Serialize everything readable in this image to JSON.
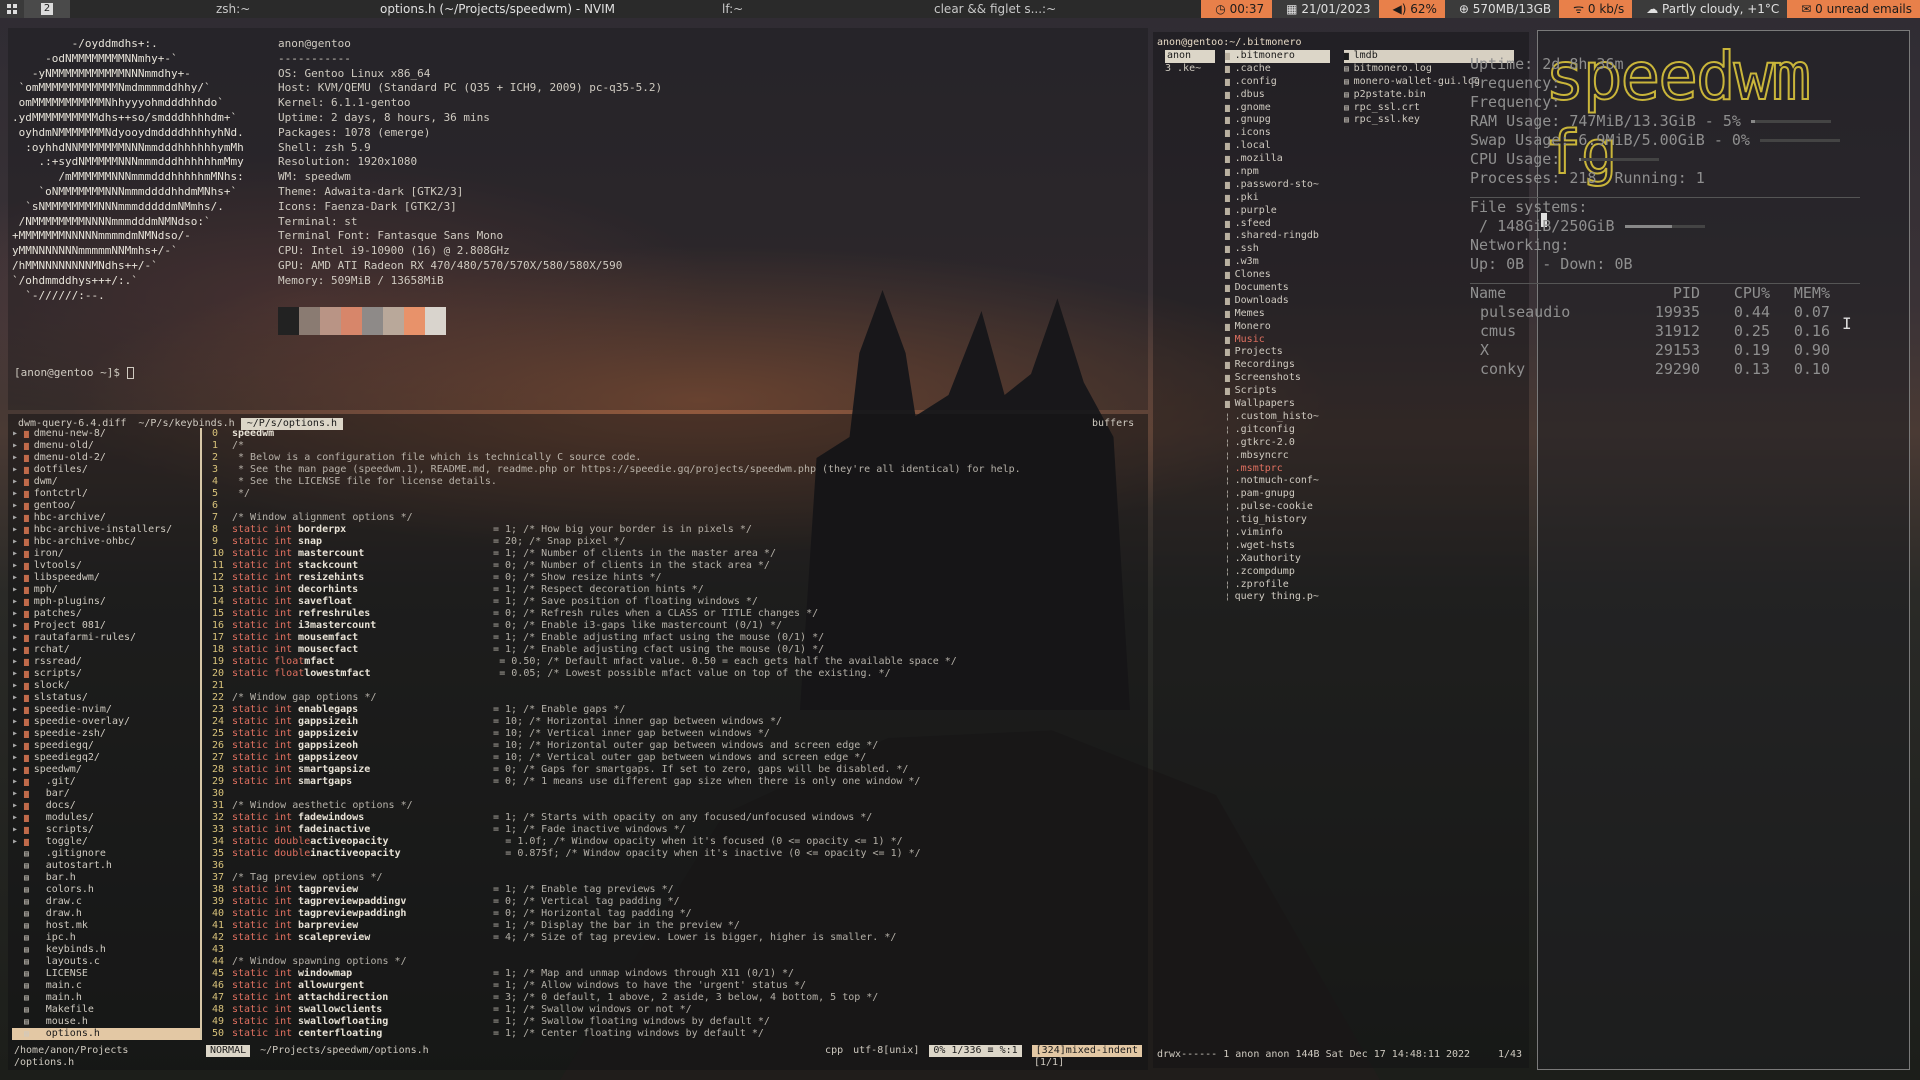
{
  "topbar": {
    "tags": [
      "1",
      "2"
    ],
    "titles": {
      "zsh": "zsh:~",
      "nvim": "options.h (~/Projects/speedwm) - NVIM",
      "lf": "lf:~",
      "clear": "clear && figlet s...:~"
    },
    "time": "00:37",
    "date": "21/01/2023",
    "volume": "62%",
    "ram": "570MB/13GB",
    "net": "0 kb/s",
    "weather": "Partly cloudy, +1°C",
    "mail": "0 unread emails"
  },
  "neofetch": {
    "logo": [
      "         -/oyddmdhs+:.",
      "     -odNMMMMMMMMNNmhy+-`",
      "   -yNMMMMMMMMMMMNNNmmdhy+-",
      " `omMMMMMMMMMMMMNmdmmmmddhhy/`",
      " omMMMMMMMMMMMNhhyyyohmdddhhhdo`",
      ".ydMMMMMMMMMMdhs++so/smdddhhhhdm+`",
      " oyhdmNMMMMMMMNdyooydmddddhhhhyhNd.",
      "  :oyhhdNNMMMMMMMNNNmmdddhhhhhhymMh",
      "    .:+sydNMMMMMNNNmmmdddhhhhhhmMmy",
      "       /mMMMMMMNNNmmmdddhhhhhmMNhs:",
      "    `oNMMMMMMMNNNmmmddddhhdmMNhs+`",
      "  `sNMMMMMMMMNNNmmmdddddmNMmhs/.",
      " /NMMMMMMMMNNNNmmmdddmNMNdso:`",
      "+MMMMMMMNNNNNmmmmdmNMNdso/-",
      "yMMNNNNNNNmmmmmNNMmhs+/-`",
      "/hMMNNNNNNNNMNdhs++/-`",
      "`/ohdmmddhys+++/:.`",
      "  `-//////:--."
    ],
    "user": "anon@gentoo",
    "separator": "-----------",
    "info": [
      "OS: Gentoo Linux x86_64",
      "Host: KVM/QEMU (Standard PC (Q35 + ICH9, 2009) pc-q35-5.2)",
      "Kernel: 6.1.1-gentoo",
      "Uptime: 2 days, 8 hours, 36 mins",
      "Packages: 1078 (emerge)",
      "Shell: zsh 5.9",
      "Resolution: 1920x1080",
      "WM: speedwm",
      "Theme: Adwaita-dark [GTK2/3]",
      "Icons: Faenza-Dark [GTK2/3]",
      "Terminal: st",
      "Terminal Font: Fantasque Sans Mono",
      "CPU: Intel i9-10900 (16) @ 2.808GHz",
      "GPU: AMD ATI Radeon RX 470/480/570/570X/580/580X/590",
      "Memory: 509MiB / 13658MiB"
    ],
    "palette": [
      "#222222",
      "#8a7b72",
      "#b99485",
      "#d7866a",
      "#8e8a88",
      "#b9a89a",
      "#e8926a",
      "#d9d4cd"
    ],
    "prompt": "[anon@gentoo ~]$ "
  },
  "nvim": {
    "tabs": [
      "dwm-query-6.4.diff",
      "~/P/s/keybinds.h",
      "~/P/s/options.h"
    ],
    "buffers_label": "buffers",
    "tree": [
      "dmenu-new-8/",
      "dmenu-old/",
      "dmenu-old-2/",
      "dotfiles/",
      "dwm/",
      "fontctrl/",
      "gentoo/",
      "hbc-archive/",
      "hbc-archive-installers/",
      "hbc-archive-ohbc/",
      "iron/",
      "lvtools/",
      "libspeedwm/",
      "mph/",
      "mph-plugins/",
      "patches/",
      "Project 081/",
      "rautafarmi-rules/",
      "rchat/",
      "rssread/",
      "scripts/",
      "slock/",
      "slstatus/",
      "speedie-nvim/",
      "speedie-overlay/",
      "speedie-zsh/",
      "speediegq/",
      "speediegq2/",
      "speedwm/",
      "  .git/",
      "  bar/",
      "  docs/",
      "  modules/",
      "  scripts/",
      "  toggle/",
      "  .gitignore",
      "  autostart.h",
      "  bar.h",
      "  colors.h",
      "  draw.c",
      "  draw.h",
      "  host.mk",
      "  ipc.h",
      "  keybinds.h",
      "  layouts.c",
      "  LICENSE",
      "  main.c",
      "  main.h",
      "  Makefile",
      "  mouse.h",
      "  options.h"
    ],
    "tree_footer": "/home/anon/Projects",
    "code": [
      {
        "n": "0",
        "t": "",
        "v": "speedwm",
        "c": ""
      },
      {
        "n": "1",
        "t": "",
        "v": "",
        "c": "/*"
      },
      {
        "n": "2",
        "t": "",
        "v": "",
        "c": " * Below is a configuration file which is technically C source code."
      },
      {
        "n": "3",
        "t": "",
        "v": "",
        "c": " * See the man page (speedwm.1), README.md, readme.php or https://speedie.gq/projects/speedwm.php (they're all identical) for help."
      },
      {
        "n": "4",
        "t": "",
        "v": "",
        "c": " * See the LICENSE file for license details."
      },
      {
        "n": "5",
        "t": "",
        "v": "",
        "c": " */"
      },
      {
        "n": "6",
        "t": "",
        "v": "",
        "c": ""
      },
      {
        "n": "7",
        "t": "",
        "v": "",
        "c": "/* Window alignment options */"
      },
      {
        "n": "8",
        "t": "static int",
        "v": "borderpx",
        "c": "= 1; /* How big your border is in pixels */"
      },
      {
        "n": "9",
        "t": "static int",
        "v": "snap",
        "c": "= 20; /* Snap pixel */"
      },
      {
        "n": "10",
        "t": "static int",
        "v": "mastercount",
        "c": "= 1; /* Number of clients in the master area */"
      },
      {
        "n": "11",
        "t": "static int",
        "v": "stackcount",
        "c": "= 0; /* Number of clients in the stack area */"
      },
      {
        "n": "12",
        "t": "static int",
        "v": "resizehints",
        "c": "= 0; /* Show resize hints */"
      },
      {
        "n": "13",
        "t": "static int",
        "v": "decorhints",
        "c": "= 1; /* Respect decoration hints */"
      },
      {
        "n": "14",
        "t": "static int",
        "v": "savefloat",
        "c": "= 1; /* Save position of floating windows */"
      },
      {
        "n": "15",
        "t": "static int",
        "v": "refreshrules",
        "c": "= 0; /* Refresh rules when a CLASS or TITLE changes */"
      },
      {
        "n": "16",
        "t": "static int",
        "v": "i3mastercount",
        "c": "= 0; /* Enable i3-gaps like mastercount (0/1) */"
      },
      {
        "n": "17",
        "t": "static int",
        "v": "mousemfact",
        "c": "= 1; /* Enable adjusting mfact using the mouse (0/1) */"
      },
      {
        "n": "18",
        "t": "static int",
        "v": "mousecfact",
        "c": "= 1; /* Enable adjusting cfact using the mouse (0/1) */"
      },
      {
        "n": "19",
        "t": "static float",
        "v": "mfact",
        "c": "= 0.50; /* Default mfact value. 0.50 = each gets half the available space */"
      },
      {
        "n": "20",
        "t": "static float",
        "v": "lowestmfact",
        "c": "= 0.05; /* Lowest possible mfact value on top of the existing. */"
      },
      {
        "n": "21",
        "t": "",
        "v": "",
        "c": ""
      },
      {
        "n": "22",
        "t": "",
        "v": "",
        "c": "/* Window gap options */"
      },
      {
        "n": "23",
        "t": "static int",
        "v": "enablegaps",
        "c": "= 1; /* Enable gaps */"
      },
      {
        "n": "24",
        "t": "static int",
        "v": "gappsizeih",
        "c": "= 10; /* Horizontal inner gap between windows */"
      },
      {
        "n": "25",
        "t": "static int",
        "v": "gappsizeiv",
        "c": "= 10; /* Vertical inner gap between windows */"
      },
      {
        "n": "26",
        "t": "static int",
        "v": "gappsizeoh",
        "c": "= 10; /* Horizontal outer gap between windows and screen edge */"
      },
      {
        "n": "27",
        "t": "static int",
        "v": "gappsizeov",
        "c": "= 10; /* Vertical outer gap between windows and screen edge */"
      },
      {
        "n": "28",
        "t": "static int",
        "v": "smartgapsize",
        "c": "= 0; /* Gaps for smartgaps. If set to zero, gaps will be disabled. */"
      },
      {
        "n": "29",
        "t": "static int",
        "v": "smartgaps",
        "c": "= 0; /* 1 means use different gap size when there is only one window */"
      },
      {
        "n": "30",
        "t": "",
        "v": "",
        "c": ""
      },
      {
        "n": "31",
        "t": "",
        "v": "",
        "c": "/* Window aesthetic options */"
      },
      {
        "n": "32",
        "t": "static int",
        "v": "fadewindows",
        "c": "= 1; /* Starts with opacity on any focused/unfocused windows */"
      },
      {
        "n": "33",
        "t": "static int",
        "v": "fadeinactive",
        "c": "= 1; /* Fade inactive windows */"
      },
      {
        "n": "34",
        "t": "static double",
        "v": "activeopacity",
        "c": "= 1.0f; /* Window opacity when it's focused (0 <= opacity <= 1) */"
      },
      {
        "n": "35",
        "t": "static double",
        "v": "inactiveopacity",
        "c": "= 0.875f; /* Window opacity when it's inactive (0 <= opacity <= 1) */"
      },
      {
        "n": "36",
        "t": "",
        "v": "",
        "c": ""
      },
      {
        "n": "37",
        "t": "",
        "v": "",
        "c": "/* Tag preview options */"
      },
      {
        "n": "38",
        "t": "static int",
        "v": "tagpreview",
        "c": "= 1; /* Enable tag previews */"
      },
      {
        "n": "39",
        "t": "static int",
        "v": "tagpreviewpaddingv",
        "c": "= 0; /* Vertical tag padding */"
      },
      {
        "n": "40",
        "t": "static int",
        "v": "tagpreviewpaddingh",
        "c": "= 0; /* Horizontal tag padding */"
      },
      {
        "n": "41",
        "t": "static int",
        "v": "barpreview",
        "c": "= 1; /* Display the bar in the preview */"
      },
      {
        "n": "42",
        "t": "static int",
        "v": "scalepreview",
        "c": "= 4; /* Size of tag preview. Lower is bigger, higher is smaller. */"
      },
      {
        "n": "43",
        "t": "",
        "v": "",
        "c": ""
      },
      {
        "n": "44",
        "t": "",
        "v": "",
        "c": "/* Window spawning options */"
      },
      {
        "n": "45",
        "t": "static int",
        "v": "windowmap",
        "c": "= 1; /* Map and unmap windows through X11 (0/1) */"
      },
      {
        "n": "46",
        "t": "static int",
        "v": "allowurgent",
        "c": "= 1; /* Allow windows to have the 'urgent' status */"
      },
      {
        "n": "47",
        "t": "static int",
        "v": "attachdirection",
        "c": "= 3; /* 0 default, 1 above, 2 aside, 3 below, 4 bottom, 5 top */"
      },
      {
        "n": "48",
        "t": "static int",
        "v": "swallowclients",
        "c": "= 1; /* Swallow windows or not */"
      },
      {
        "n": "49",
        "t": "static int",
        "v": "swallowfloating",
        "c": "= 1; /* Swallow floating windows by default */"
      },
      {
        "n": "50",
        "t": "static int",
        "v": "centerfloating",
        "c": "= 1; /* Center floating windows by default */"
      }
    ],
    "status": {
      "mode": "NORMAL",
      "file": "~/Projects/speedwm/options.h",
      "filetype": "cpp",
      "encoding": "utf-8[unix]",
      "position": "0% 1/336 ≡ %:1",
      "indent": "[324]mixed-indent",
      "page": "[1/1]",
      "tree_file": "/options.h"
    }
  },
  "lf": {
    "header": "anon@gentoo:~/.bitmonero",
    "parent": [
      "anon",
      "3 .ke~"
    ],
    "current": [
      ".bitmonero",
      ".cache",
      ".config",
      ".dbus",
      ".gnome",
      ".gnupg",
      ".icons",
      ".local",
      ".mozilla",
      ".npm",
      ".password-sto~",
      ".pki",
      ".purple",
      ".sfeed",
      ".shared-ringdb",
      ".ssh",
      ".w3m",
      "Clones",
      "Documents",
      "Downloads",
      "Memes",
      "Monero",
      "Music",
      "Projects",
      "Recordings",
      "Screenshots",
      "Scripts",
      "Wallpapers",
      ".custom_histo~",
      ".gitconfig",
      ".gtkrc-2.0",
      ".mbsyncrc",
      ".msmtprc",
      ".notmuch-conf~",
      ".pam-gnupg",
      ".pulse-cookie",
      ".tig_history",
      ".viminfo",
      ".wget-hsts",
      ".Xauthority",
      ".zcompdump",
      ".zprofile",
      "query thing.p~"
    ],
    "preview": [
      "lmdb",
      "bitmonero.log",
      "monero-wallet-gui.log",
      "p2pstate.bin",
      "rpc_ssl.crt",
      "rpc_ssl.key"
    ],
    "footer": "drwx------ 1 anon anon 144B Sat Dec 17 14:48:11 2022",
    "count": "1/43"
  },
  "figlet": {
    "line1": "speedwm",
    "line2": "fg"
  },
  "conky": {
    "lines": [
      "Uptime: 2d 8h 36m",
      "Frequency: ",
      "Frequency: ",
      "RAM Usage: 747MiB/13.3GiB - 5%",
      "Swap Usage: 6.9MiB/5.00GiB - 0%",
      "CPU Usage: ",
      "Processes: 218  Running: 1",
      "",
      "File systems:",
      " / 148GiB/250GiB",
      "Networking:",
      "Up: 0B  - Down: 0B"
    ],
    "table_head": [
      "Name",
      "PID",
      "CPU%",
      "MEM%"
    ],
    "processes": [
      [
        "pulseaudio",
        "19935",
        "0.44",
        "0.07"
      ],
      [
        "cmus",
        "31912",
        "0.25",
        "0.16"
      ],
      [
        "X",
        "29153",
        "0.19",
        "0.90"
      ],
      [
        "conky",
        "29290",
        "0.13",
        "0.10"
      ]
    ],
    "ram_pct": 0.05,
    "swap_pct": 0.0,
    "fs_pct": 0.59
  }
}
